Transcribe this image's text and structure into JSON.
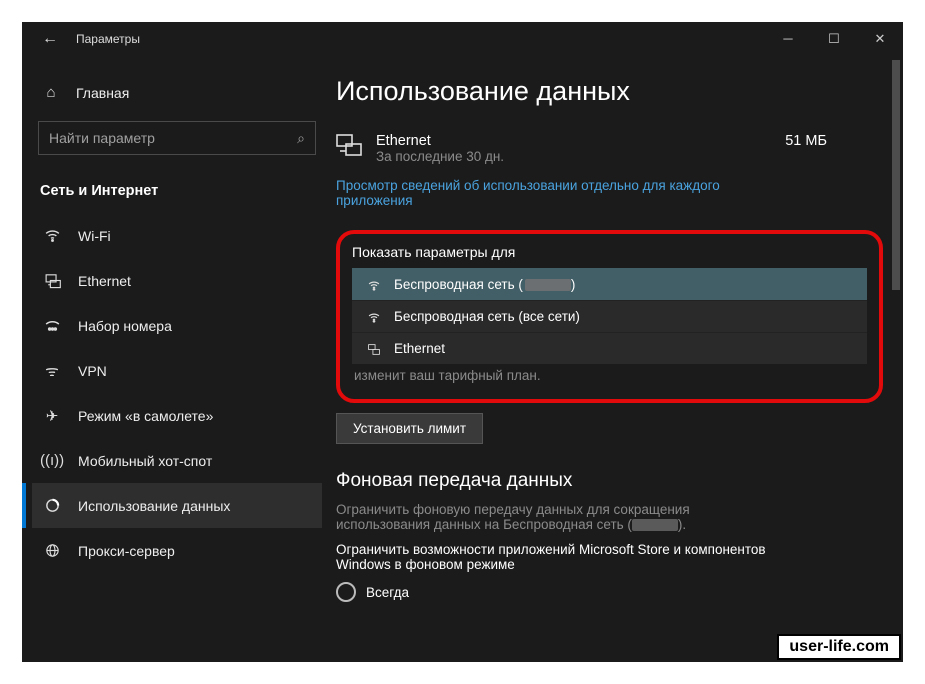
{
  "titlebar": {
    "back": "←",
    "title": "Параметры"
  },
  "sidebar": {
    "home": "Главная",
    "search_placeholder": "Найти параметр",
    "category": "Сеть и Интернет",
    "items": [
      {
        "label": "Wi-Fi",
        "icon": "wifi"
      },
      {
        "label": "Ethernet",
        "icon": "ethernet"
      },
      {
        "label": "Набор номера",
        "icon": "dialup"
      },
      {
        "label": "VPN",
        "icon": "vpn"
      },
      {
        "label": "Режим «в самолете»",
        "icon": "airplane"
      },
      {
        "label": "Мобильный хот-спот",
        "icon": "hotspot"
      },
      {
        "label": "Использование данных",
        "icon": "datausage"
      },
      {
        "label": "Прокси-сервер",
        "icon": "proxy"
      }
    ],
    "active_index": 6
  },
  "page": {
    "title": "Использование данных",
    "net_name": "Ethernet",
    "net_period": "За последние 30 дн.",
    "net_usage": "51 МБ",
    "perapp_link": "Просмотр сведений об использовании отдельно для каждого приложения",
    "dropdown": {
      "label": "Показать параметры для",
      "options": [
        {
          "prefix": "Беспроводная сеть (",
          "suffix": ")",
          "icon": "wifi",
          "redacted": true,
          "selected": true
        },
        {
          "prefix": "Беспроводная сеть (все сети)",
          "suffix": "",
          "icon": "wifi",
          "redacted": false,
          "selected": false
        },
        {
          "prefix": "Ethernet",
          "suffix": "",
          "icon": "ethernet",
          "redacted": false,
          "selected": false
        }
      ]
    },
    "trailing_text": "изменит ваш тарифный план.",
    "set_limit_button": "Установить лимит",
    "bg_section": {
      "title": "Фоновая передача данных",
      "desc_prefix": "Ограничить фоновую передачу данных для сокращения использования данных на Беспроводная сеть (",
      "desc_suffix": ").",
      "restrict_label": "Ограничить возможности приложений Microsoft Store и компонентов Windows в фоновом режиме",
      "radio_always": "Всегда"
    }
  },
  "watermark": "user-life.com"
}
